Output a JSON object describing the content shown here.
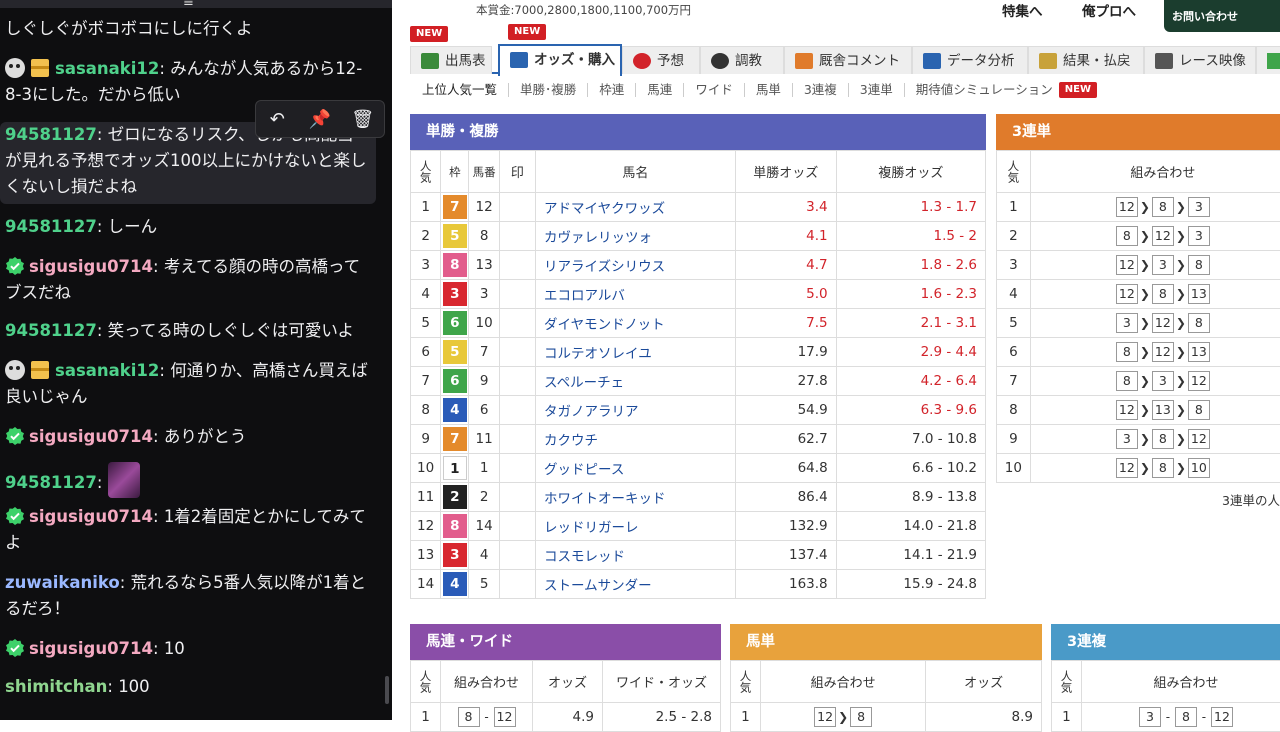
{
  "chat": {
    "messages": [
      {
        "user": "",
        "user_color": "#efeff1",
        "text": "しぐしぐがボコボコにしに行くよ",
        "badges": []
      },
      {
        "user": "sasanaki12",
        "user_color": "#4fd18b",
        "text": "みんなが人気あるから12-8-3にした。だから低い",
        "badges": [
          "skull",
          "gift"
        ]
      },
      {
        "user": "94581127",
        "user_color": "#4fd18b",
        "text": "ゼロになるリスク、しかも高配当が見れる予想でオッズ100以上にかけないと楽しくないし損だよね",
        "badges": []
      },
      {
        "user": "94581127",
        "user_color": "#4fd18b",
        "text": "しーん",
        "badges": []
      },
      {
        "user": "sigusigu0714",
        "user_color": "#f4a9c1",
        "text": "考えてる顔の時の高橋ってブスだね",
        "badges": [
          "verified"
        ]
      },
      {
        "user": "94581127",
        "user_color": "#4fd18b",
        "text": "笑ってる時のしぐしぐは可愛いよ",
        "badges": []
      },
      {
        "user": "sasanaki12",
        "user_color": "#4fd18b",
        "text": "何通りか、高橋さん買えば良いじゃん",
        "badges": [
          "skull",
          "gift"
        ]
      },
      {
        "user": "sigusigu0714",
        "user_color": "#f4a9c1",
        "text": "ありがとう",
        "badges": [
          "verified"
        ]
      },
      {
        "user": "94581127",
        "user_color": "#4fd18b",
        "text": "",
        "badges": [],
        "emote": "emote"
      },
      {
        "user": "sigusigu0714",
        "user_color": "#f4a9c1",
        "text": "1着2着固定とかにしてみてよ",
        "badges": [
          "verified"
        ]
      },
      {
        "user": "zuwaikaniko",
        "user_color": "#9ab8ff",
        "text": "荒れるなら5番人気以降が1着とるだろ！",
        "badges": []
      },
      {
        "user": "sigusigu0714",
        "user_color": "#f4a9c1",
        "text": "10",
        "badges": [
          "verified"
        ]
      },
      {
        "user": "shimitchan",
        "user_color": "#8fd58f",
        "text": "100",
        "badges": []
      }
    ]
  },
  "site": {
    "prize": "本賞金:7000,2800,1800,1100,700万円",
    "topnav": [
      "特集へ",
      "俺プロへ"
    ],
    "contact": "お問い合わせ",
    "new_label": "NEW",
    "tabs": [
      "出馬表",
      "オッズ・購入",
      "予想",
      "調教",
      "厩舎コメント",
      "データ分析",
      "結果・払戻",
      "レース映像"
    ],
    "subtabs": [
      "上位人気一覧",
      "単勝･複勝",
      "枠連",
      "馬連",
      "ワイド",
      "馬単",
      "3連複",
      "3連単",
      "期待値シミュレーション"
    ],
    "win_place": {
      "title": "単勝・複勝",
      "headers": [
        "人気",
        "枠",
        "馬番",
        "印",
        "馬名",
        "単勝オッズ",
        "複勝オッズ"
      ],
      "rows": [
        {
          "pop": "1",
          "waku": "7",
          "num": "12",
          "name": "アドマイヤクワッズ",
          "win": "3.4",
          "place": "1.3 - 1.7",
          "wc": true,
          "pc": true
        },
        {
          "pop": "2",
          "waku": "5",
          "num": "8",
          "name": "カヴァレリッツォ",
          "win": "4.1",
          "place": "1.5 - 2",
          "wc": true,
          "pc": true
        },
        {
          "pop": "3",
          "waku": "8",
          "num": "13",
          "name": "リアライズシリウス",
          "win": "4.7",
          "place": "1.8 - 2.6",
          "wc": true,
          "pc": true
        },
        {
          "pop": "4",
          "waku": "3",
          "num": "3",
          "name": "エコロアルバ",
          "win": "5.0",
          "place": "1.6 - 2.3",
          "wc": true,
          "pc": true
        },
        {
          "pop": "5",
          "waku": "6",
          "num": "10",
          "name": "ダイヤモンドノット",
          "win": "7.5",
          "place": "2.1 - 3.1",
          "wc": true,
          "pc": true
        },
        {
          "pop": "6",
          "waku": "5",
          "num": "7",
          "name": "コルテオソレイユ",
          "win": "17.9",
          "place": "2.9 - 4.4",
          "wc": false,
          "pc": true
        },
        {
          "pop": "7",
          "waku": "6",
          "num": "9",
          "name": "スペルーチェ",
          "win": "27.8",
          "place": "4.2 - 6.4",
          "wc": false,
          "pc": true
        },
        {
          "pop": "8",
          "waku": "4",
          "num": "6",
          "name": "タガノアラリア",
          "win": "54.9",
          "place": "6.3 - 9.6",
          "wc": false,
          "pc": true
        },
        {
          "pop": "9",
          "waku": "7",
          "num": "11",
          "name": "カクウチ",
          "win": "62.7",
          "place": "7.0 - 10.8",
          "wc": false,
          "pc": false
        },
        {
          "pop": "10",
          "waku": "1",
          "num": "1",
          "name": "グッドピース",
          "win": "64.8",
          "place": "6.6 - 10.2",
          "wc": false,
          "pc": false
        },
        {
          "pop": "11",
          "waku": "2",
          "num": "2",
          "name": "ホワイトオーキッド",
          "win": "86.4",
          "place": "8.9 - 13.8",
          "wc": false,
          "pc": false
        },
        {
          "pop": "12",
          "waku": "8",
          "num": "14",
          "name": "レッドリガーレ",
          "win": "132.9",
          "place": "14.0 - 21.8",
          "wc": false,
          "pc": false
        },
        {
          "pop": "13",
          "waku": "3",
          "num": "4",
          "name": "コスモレッド",
          "win": "137.4",
          "place": "14.1 - 21.9",
          "wc": false,
          "pc": false
        },
        {
          "pop": "14",
          "waku": "4",
          "num": "5",
          "name": "ストームサンダー",
          "win": "163.8",
          "place": "15.9 - 24.8",
          "wc": false,
          "pc": false
        }
      ]
    },
    "trifecta": {
      "title": "3連単",
      "headers": [
        "人気",
        "組み合わせ"
      ],
      "rows": [
        {
          "pop": "1",
          "combo": [
            "12",
            "8",
            "3"
          ]
        },
        {
          "pop": "2",
          "combo": [
            "8",
            "12",
            "3"
          ]
        },
        {
          "pop": "3",
          "combo": [
            "12",
            "3",
            "8"
          ]
        },
        {
          "pop": "4",
          "combo": [
            "12",
            "8",
            "13"
          ]
        },
        {
          "pop": "5",
          "combo": [
            "3",
            "12",
            "8"
          ]
        },
        {
          "pop": "6",
          "combo": [
            "8",
            "12",
            "13"
          ]
        },
        {
          "pop": "7",
          "combo": [
            "8",
            "3",
            "12"
          ]
        },
        {
          "pop": "8",
          "combo": [
            "12",
            "13",
            "8"
          ]
        },
        {
          "pop": "9",
          "combo": [
            "3",
            "8",
            "12"
          ]
        },
        {
          "pop": "10",
          "combo": [
            "12",
            "8",
            "10"
          ]
        }
      ],
      "footer": "3連単の人"
    },
    "quinella": {
      "title": "馬連・ワイド",
      "headers": [
        "人気",
        "組み合わせ",
        "オッズ",
        "ワイド・オッズ"
      ],
      "row": {
        "pop": "1",
        "combo": [
          "8",
          "12"
        ],
        "odds": "4.9",
        "wide": "2.5 - 2.8"
      }
    },
    "exacta": {
      "title": "馬単",
      "headers": [
        "人気",
        "組み合わせ",
        "オッズ"
      ],
      "row": {
        "pop": "1",
        "combo": [
          "12",
          "8"
        ],
        "odds": "8.9"
      }
    },
    "trio": {
      "title": "3連複",
      "headers": [
        "人気",
        "組み合わせ"
      ],
      "row": {
        "pop": "1",
        "combo": [
          "3",
          "8",
          "12"
        ]
      }
    }
  },
  "colors": {
    "waku": {
      "1": "#ffffff",
      "2": "#222222",
      "3": "#d8272f",
      "4": "#2a5bb8",
      "5": "#e8c83a",
      "6": "#3fa54a",
      "7": "#e48a2b",
      "8": "#e25d8c"
    },
    "win_head": "#5961b8",
    "tri_head": "#e07b2b",
    "quin_head": "#8a4ea8",
    "exacta_head": "#e8a23c",
    "trio_head": "#4a9ac8"
  }
}
